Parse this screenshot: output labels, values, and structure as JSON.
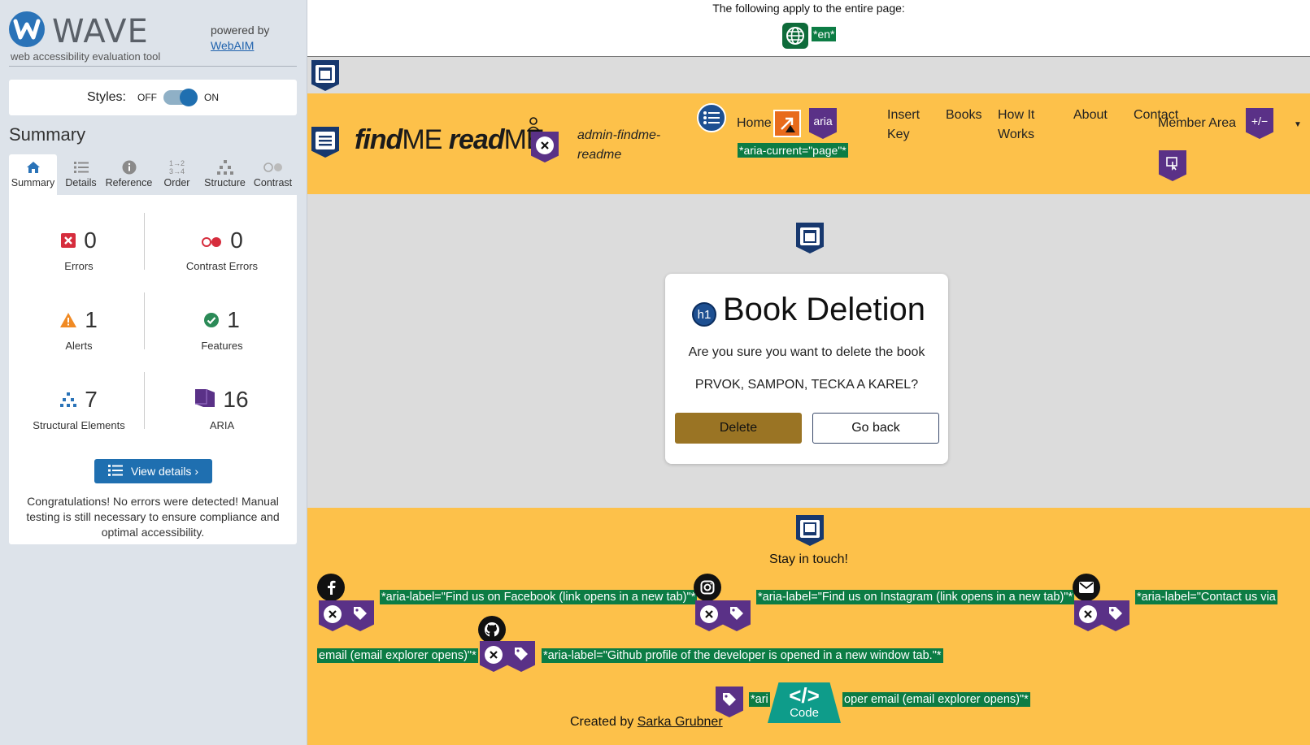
{
  "wave": {
    "logo_word": "WAVE",
    "tagline": "web accessibility evaluation tool",
    "powered_by": "powered by",
    "webaim_link": "WebAIM",
    "styles_label": "Styles:",
    "styles_off": "OFF",
    "styles_on": "ON",
    "summary_title": "Summary",
    "tabs": [
      {
        "label": "Summary",
        "icon": "home-icon"
      },
      {
        "label": "Details",
        "icon": "list-icon"
      },
      {
        "label": "Reference",
        "icon": "info-icon"
      },
      {
        "label": "Order",
        "icon": "order-icon"
      },
      {
        "label": "Structure",
        "icon": "structure-icon"
      },
      {
        "label": "Contrast",
        "icon": "contrast-icon"
      }
    ],
    "stats": {
      "errors": {
        "value": "0",
        "label": "Errors",
        "color": "#d62d3d"
      },
      "contrast_errors": {
        "value": "0",
        "label": "Contrast Errors",
        "color": "#d62d3d"
      },
      "alerts": {
        "value": "1",
        "label": "Alerts",
        "color": "#f08a24"
      },
      "features": {
        "value": "1",
        "label": "Features",
        "color": "#2b8a57"
      },
      "structural": {
        "value": "7",
        "label": "Structural Elements",
        "color": "#2a73b8"
      },
      "aria": {
        "value": "16",
        "label": "ARIA",
        "color": "#5a3187"
      }
    },
    "view_details": "View details ›",
    "congrats": "Congratulations! No errors were detected! Manual testing is still necessary to ensure compliance and optimal accessibility."
  },
  "page": {
    "applies_text": "The following apply to the entire page:",
    "lang_tag": "*en*",
    "brand_find": "find",
    "brand_me1": "ME",
    "brand_read": "read",
    "brand_me2": "ME",
    "admin_user": "admin-findme-readme",
    "nav": {
      "home": "Home",
      "aria_label": "aria",
      "aria_current": "*aria-current=\"page\"*",
      "insert_key_1": "Insert",
      "insert_key_2": "Key",
      "books": "Books",
      "how_1": "How It",
      "how_2": "Works",
      "about": "About",
      "contact": "Contact",
      "member_area": "Member Area",
      "plusminus": "+/−"
    },
    "card": {
      "h1_badge": "h1",
      "title": "Book Deletion",
      "question": "Are you sure you want to delete the book",
      "book_name": "PRVOK, SAMPON, TECKA A KAREL?",
      "delete": "Delete",
      "go_back": "Go back"
    },
    "footer": {
      "stay": "Stay in touch!",
      "fb_label": "*aria-label=\"Find us on Facebook (link opens in a new tab)\"*",
      "ig_label": "*aria-label=\"Find us on Instagram (link opens in a new tab)\"*",
      "mail_label_1": "*aria-label=\"Contact us via",
      "mail_label_2": "email (email explorer opens)\"*",
      "gh_label": "*aria-label=\"Github profile of the developer is opened in a new window tab.\"*",
      "created_by": "Created by",
      "author": "Sarka Grubner",
      "author_label_a": "*ari",
      "author_label_b": "oper email (email explorer opens)\"*",
      "code_symbol": "</>",
      "code_label": "Code"
    }
  }
}
